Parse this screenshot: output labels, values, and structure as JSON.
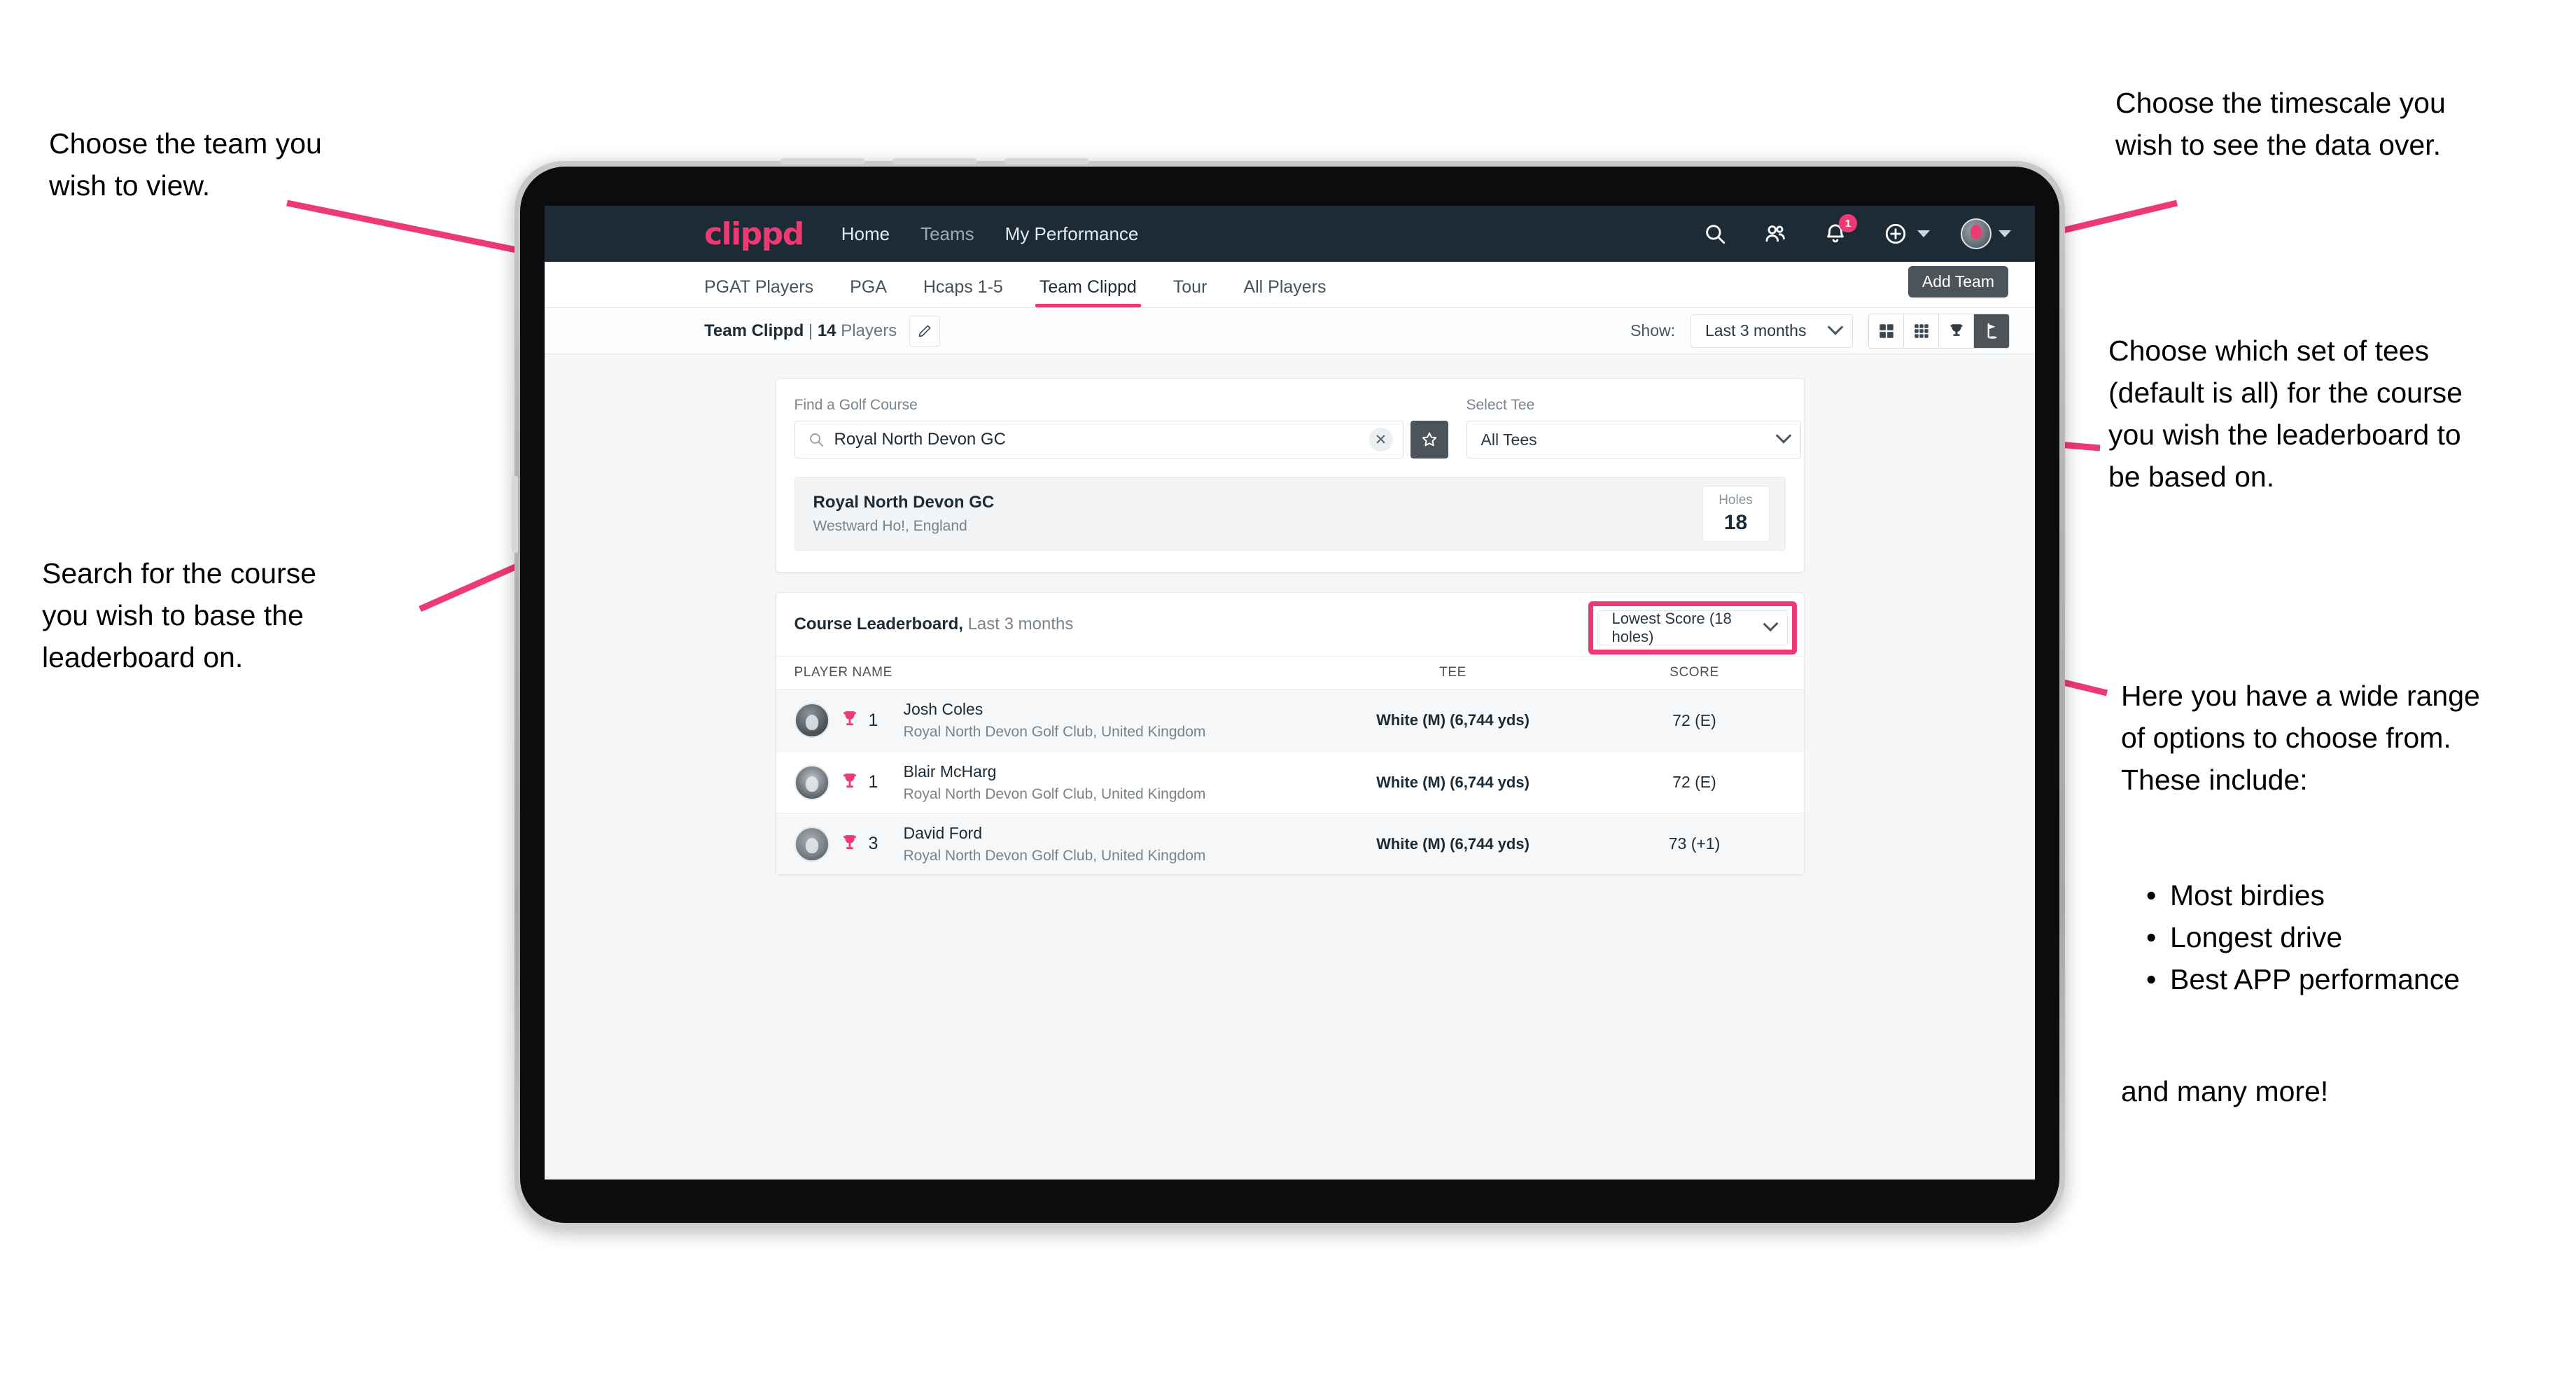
{
  "annotations": {
    "left_top": "Choose the team you\nwish to view.",
    "left_mid": "Search for the course\nyou wish to base the\nleaderboard on.",
    "right_top": "Choose the timescale you\nwish to see the data over.",
    "right_tees": "Choose which set of tees\n(default is all) for the course\nyou wish the leaderboard to\nbe based on.",
    "right_options_intro": "Here you have a wide range\nof options to choose from.\nThese include:",
    "right_options_list": [
      "Most birdies",
      "Longest drive",
      "Best APP performance"
    ],
    "right_options_outro": "and many more!",
    "accent_color": "#ec3a72"
  },
  "app": {
    "brand": "clippd",
    "nav": [
      {
        "label": "Home",
        "active": true
      },
      {
        "label": "Teams",
        "active": false
      },
      {
        "label": "My Performance",
        "active": true
      }
    ],
    "header_icons": {
      "search": "search-icon",
      "people": "people-icon",
      "notifications": "bell-icon",
      "notification_count": "1",
      "add": "plus-circle-icon",
      "avatar": "avatar-icon"
    },
    "tabs": [
      {
        "label": "PGAT Players",
        "active": false
      },
      {
        "label": "PGA",
        "active": false
      },
      {
        "label": "Hcaps 1-5",
        "active": false
      },
      {
        "label": "Team Clippd",
        "active": true
      },
      {
        "label": "Tour",
        "active": false
      },
      {
        "label": "All Players",
        "active": false
      }
    ],
    "add_team_tooltip": "Add Team",
    "subbar": {
      "team_name": "Team Clippd",
      "separator": "|",
      "player_count": "14",
      "players_word": "Players",
      "edit_icon": "pencil-icon",
      "show_label": "Show:",
      "timescale_value": "Last 3 months",
      "view_buttons": [
        {
          "icon": "grid-2x2-icon",
          "selected": false
        },
        {
          "icon": "grid-3x3-icon",
          "selected": false
        },
        {
          "icon": "trophy-icon",
          "selected": false
        },
        {
          "icon": "golf-flag-icon",
          "selected": true
        }
      ]
    },
    "search_panel": {
      "course_label": "Find a Golf Course",
      "course_value": "Royal North Devon GC",
      "course_placeholder": "Find a Golf Course",
      "search_icon": "search-icon",
      "clear_icon": "close-icon",
      "favourite_icon": "star-icon",
      "tee_label": "Select Tee",
      "tee_value": "All Tees",
      "result": {
        "name": "Royal North Devon GC",
        "location": "Westward Ho!, England",
        "holes_label": "Holes",
        "holes_value": "18"
      }
    },
    "leaderboard": {
      "title": "Course Leaderboard,",
      "subtitle": "Last 3 months",
      "metric_value": "Lowest Score (18 holes)",
      "columns": {
        "name": "PLAYER NAME",
        "tee": "TEE",
        "score": "SCORE"
      },
      "rows": [
        {
          "rank": "1",
          "name": "Josh Coles",
          "club": "Royal North Devon Golf Club, United Kingdom",
          "tee": "White (M) (6,744 yds)",
          "score": "72 (E)"
        },
        {
          "rank": "1",
          "name": "Blair McHarg",
          "club": "Royal North Devon Golf Club, United Kingdom",
          "tee": "White (M) (6,744 yds)",
          "score": "72 (E)"
        },
        {
          "rank": "3",
          "name": "David Ford",
          "club": "Royal North Devon Golf Club, United Kingdom",
          "tee": "White (M) (6,744 yds)",
          "score": "73 (+1)"
        }
      ]
    }
  }
}
